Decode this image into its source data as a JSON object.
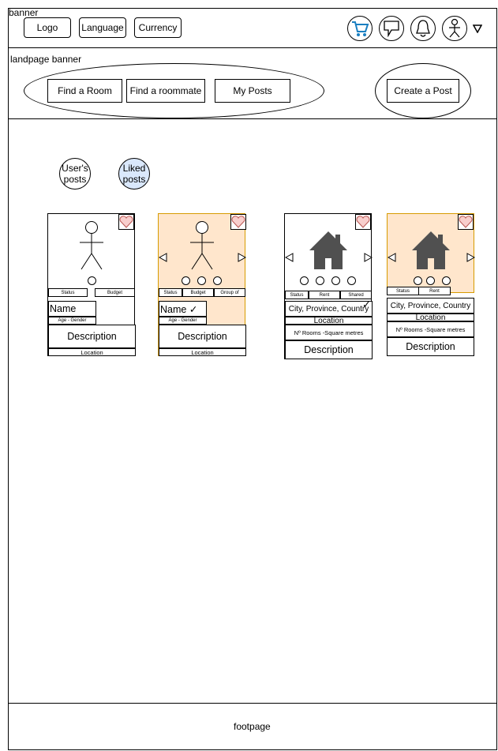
{
  "banner": {
    "title": "banner",
    "logo_label": "Logo",
    "language_label": "Language",
    "currency_label": "Currency",
    "icons": [
      "cart-icon",
      "chat-icon",
      "bell-icon",
      "user-icon",
      "dropdown-triangle-icon"
    ]
  },
  "landpage": {
    "title": "landpage banner",
    "nav": [
      "Find a Room",
      "Find a roommate",
      "My Posts"
    ],
    "create_label": "Create a Post"
  },
  "tabs": {
    "users_posts": "User's posts",
    "liked_posts": "Liked posts"
  },
  "cards": {
    "person1": {
      "status": "Status",
      "budget": "Budget",
      "name": "Name",
      "age_gender": "Age - Gender",
      "description": "Description",
      "location": "Location"
    },
    "person2": {
      "status": "Status",
      "budget": "Budget",
      "group": "Group of",
      "name": "Name ✓",
      "age_gender": "Age - Gender",
      "description": "Description",
      "location": "Location"
    },
    "room1": {
      "status": "Status",
      "rent": "Rent",
      "shared": "Shared",
      "city": "City, Province, Country",
      "location": "Location",
      "rooms": "Nº Rooms -Square metres",
      "description": "Description"
    },
    "room2": {
      "status": "Status",
      "rent": "Rent",
      "city": "City, Province, Country",
      "location": "Location",
      "rooms": "Nº Rooms -Square metres",
      "description": "Description"
    }
  },
  "footer": {
    "label": "footpage"
  },
  "colors": {
    "liked_card_fill": "#ffe6cc",
    "liked_card_border": "#d79b00",
    "liked_tab_fill": "#dae8fc",
    "heart_fill": "#f8cecc",
    "cart_blue": "#1a7fc1",
    "house_gray": "#505050"
  }
}
